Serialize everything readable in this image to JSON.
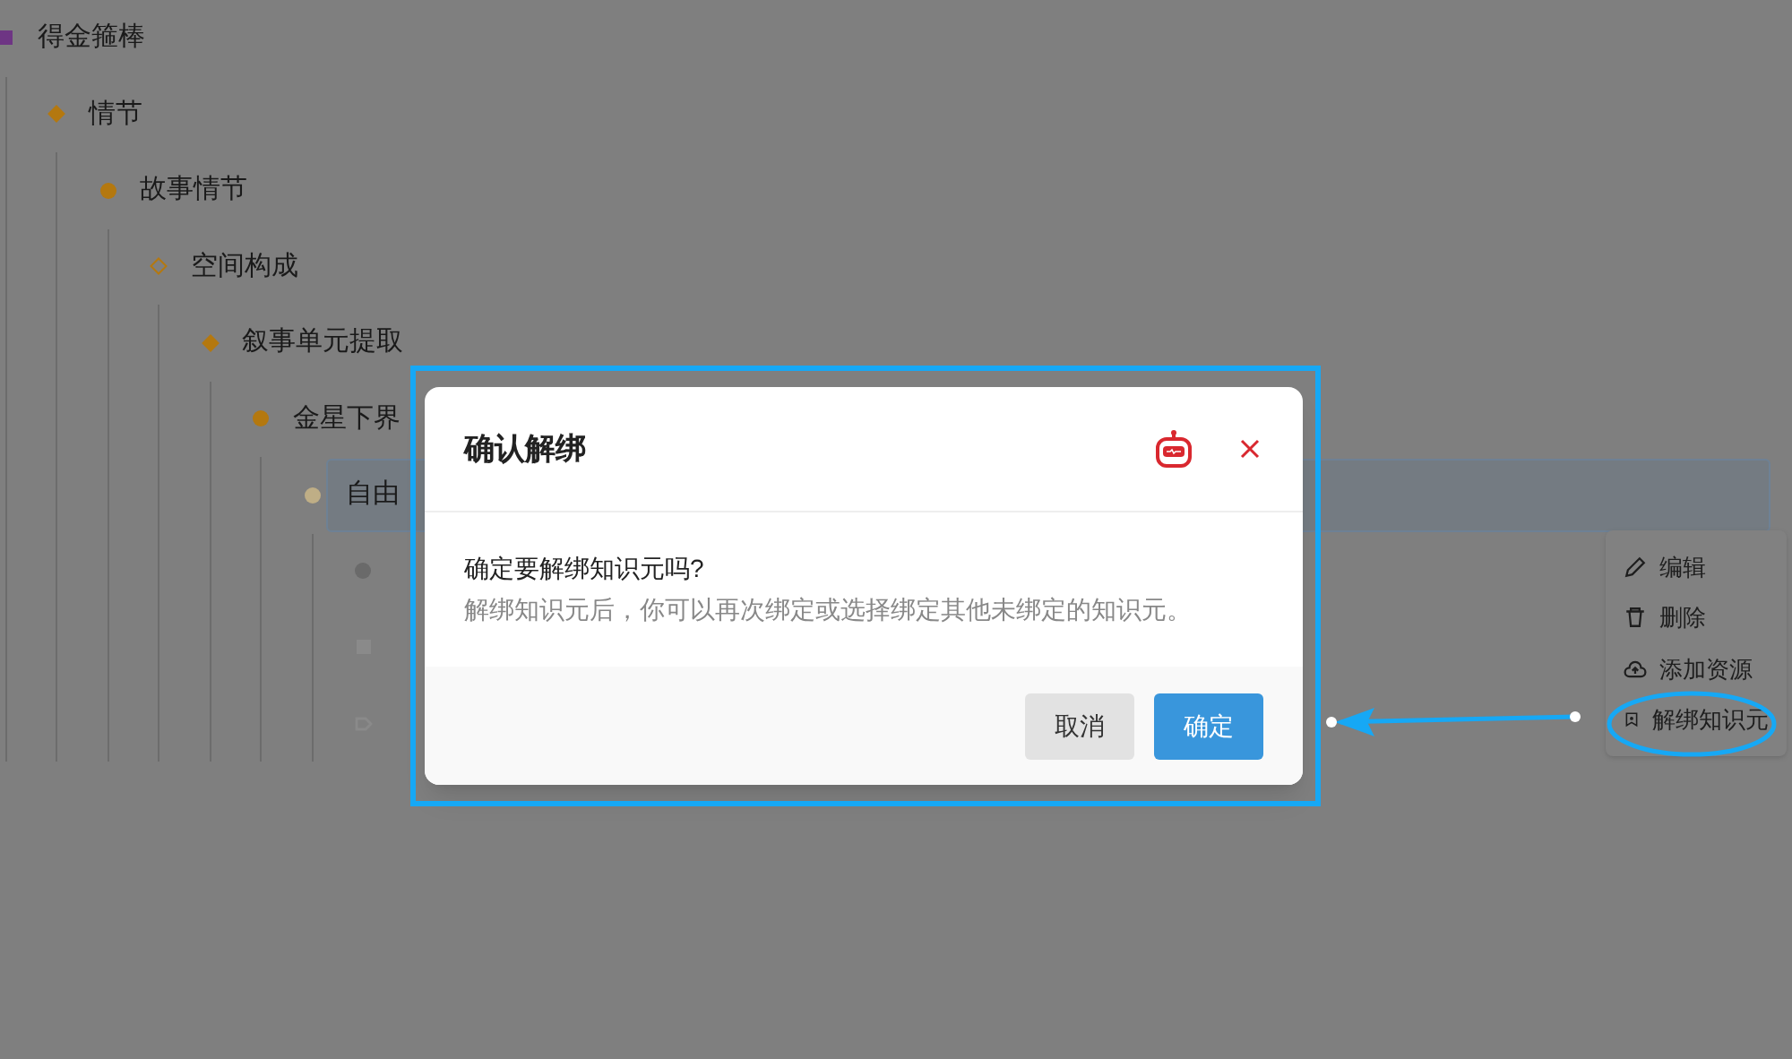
{
  "tree": [
    {
      "label": "得金箍棒",
      "kind": "square",
      "color": "#6e3584",
      "selected": false,
      "children": [
        {
          "label": "情节",
          "kind": "diamond",
          "color": "#b4780f",
          "selected": false,
          "children": [
            {
              "label": "故事情节",
              "kind": "dot",
              "color": "#b4780f",
              "selected": false,
              "children": [
                {
                  "label": "空间构成",
                  "kind": "hollow-diamond",
                  "color": "#b4780f",
                  "selected": false,
                  "children": [
                    {
                      "label": "叙事单元提取",
                      "kind": "diamond",
                      "color": "#b4780f",
                      "selected": false,
                      "children": [
                        {
                          "label": "金星下界",
                          "kind": "dot",
                          "color": "#b4780f",
                          "selected": false,
                          "children": [
                            {
                              "label": "自由",
                              "kind": "dot",
                              "color": "#bfae86",
                              "selected": true,
                              "children": [
                                {
                                  "kind": "dot",
                                  "color": "#6a6a6a"
                                },
                                {
                                  "kind": "square",
                                  "color": "#8a8a8a"
                                },
                                {
                                  "kind": "tag",
                                  "color": "#8a8a8a"
                                }
                              ]
                            }
                          ]
                        }
                      ]
                    }
                  ]
                }
              ]
            }
          ]
        }
      ]
    }
  ],
  "context_menu": [
    {
      "kind": "edit",
      "label": "编辑"
    },
    {
      "kind": "delete",
      "label": "删除"
    },
    {
      "kind": "upload",
      "label": "添加资源"
    },
    {
      "kind": "unbind",
      "label": "解绑知识元"
    }
  ],
  "dialog": {
    "title": "确认解绑",
    "question": "确定要解绑知识元吗?",
    "description": "解绑知识元后，你可以再次绑定或选择绑定其他未绑定的知识元。",
    "buttons": [
      {
        "label": "取消",
        "primary": false
      },
      {
        "label": "确定",
        "primary": true
      }
    ]
  }
}
